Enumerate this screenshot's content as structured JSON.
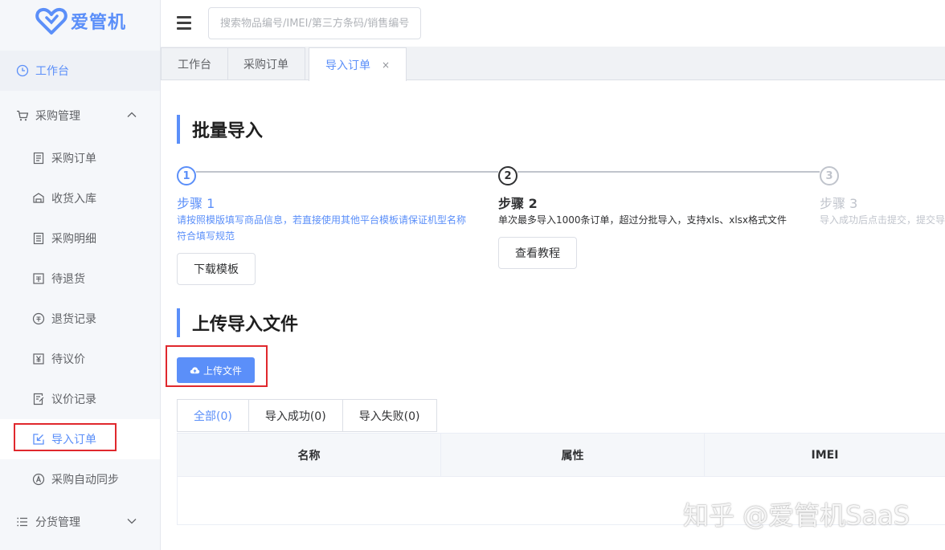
{
  "app": {
    "name": "爱管机",
    "brand_color": "#5b8ff9"
  },
  "header": {
    "search_placeholder": "搜索物品编号/IMEI/第三方条码/销售编号"
  },
  "sidebar": {
    "worktable": "工作台",
    "purchase_group": "采购管理",
    "items": [
      {
        "label": "采购订单",
        "icon": "order-doc-icon"
      },
      {
        "label": "收货入库",
        "icon": "receive-icon"
      },
      {
        "label": "采购明细",
        "icon": "detail-doc-icon"
      },
      {
        "label": "待退货",
        "icon": "return-pending-icon"
      },
      {
        "label": "退货记录",
        "icon": "return-record-icon"
      },
      {
        "label": "待议价",
        "icon": "yuan-icon"
      },
      {
        "label": "议价记录",
        "icon": "edit-doc-icon"
      },
      {
        "label": "导入订单",
        "icon": "import-icon",
        "active": true
      },
      {
        "label": "采购自动同步",
        "icon": "auto-sync-icon"
      }
    ],
    "distribution_group": "分货管理"
  },
  "tabs": [
    {
      "label": "工作台"
    },
    {
      "label": "采购订单"
    },
    {
      "label": "导入订单",
      "active": true,
      "close": "×"
    }
  ],
  "batch": {
    "title": "批量导入",
    "steps": [
      {
        "num": "1",
        "title": "步骤 1",
        "desc_line1": "请按照模版填写商品信息，若直接使用其他平台模板请保证机型名称",
        "desc_line2": "符合填写规范",
        "button": "下载模板"
      },
      {
        "num": "2",
        "title": "步骤 2",
        "desc": "单次最多导入1000条订单，超过分批导入，支持xls、xlsx格式文件",
        "button": "查看教程"
      },
      {
        "num": "3",
        "title": "步骤 3",
        "desc": "导入成功后点击提交，提交导入"
      }
    ]
  },
  "upload": {
    "title": "上传导入文件",
    "button": "上传文件"
  },
  "result_tabs": [
    "全部(0)",
    "导入成功(0)",
    "导入失败(0)"
  ],
  "table": {
    "columns": [
      "名称",
      "属性",
      "IMEI"
    ]
  },
  "watermark": "知乎 @爱管机SaaS"
}
